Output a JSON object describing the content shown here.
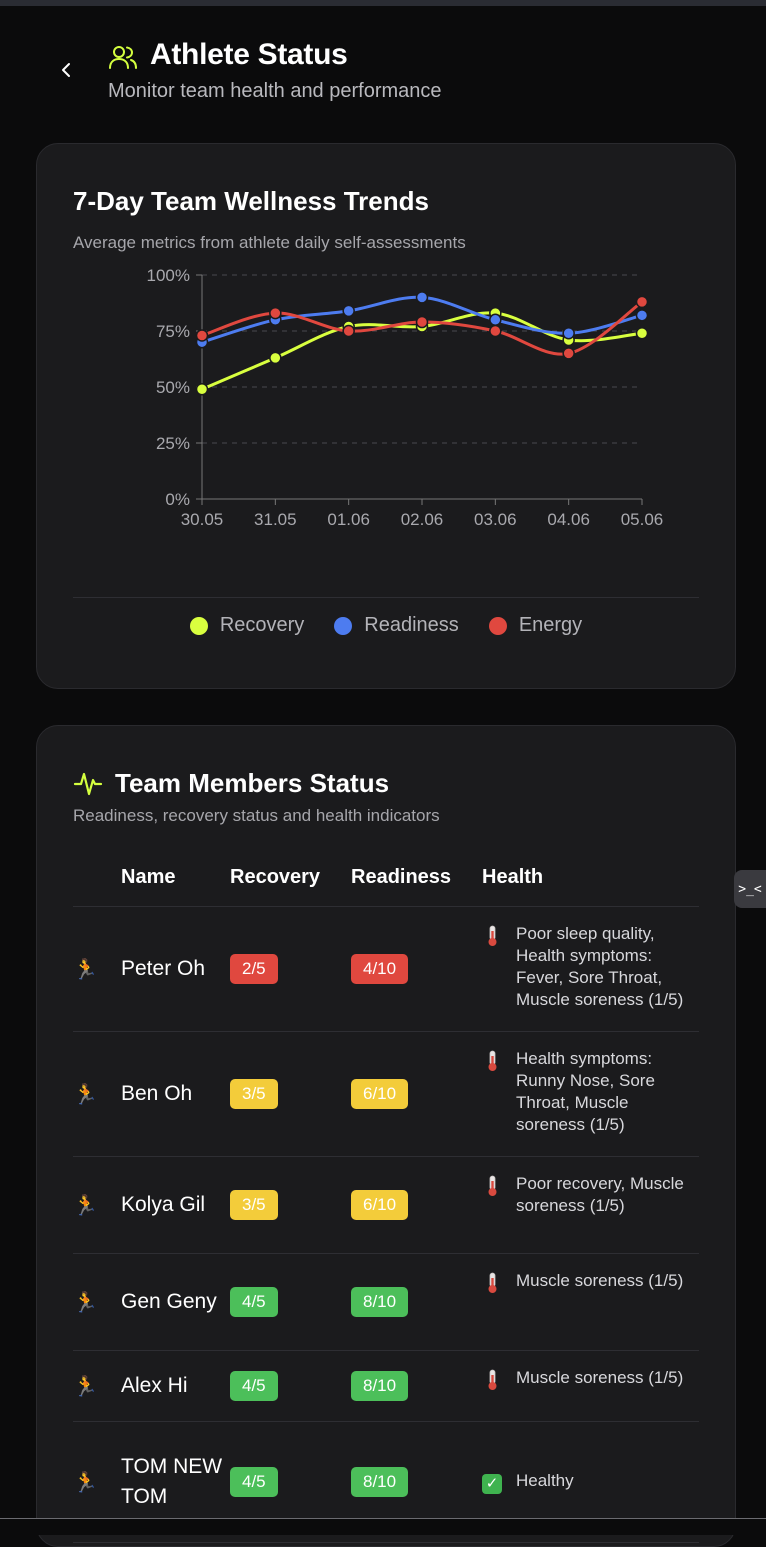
{
  "header": {
    "title": "Athlete Status",
    "subtitle": "Monitor team health and performance",
    "back_icon": "chevron-left-icon",
    "title_icon": "users-icon",
    "accent": "#d4ff3f"
  },
  "wellness_card": {
    "title": "7-Day Team Wellness Trends",
    "subtitle": "Average metrics from athlete daily self-assessments"
  },
  "chart_data": {
    "type": "line",
    "x": [
      "30.05",
      "31.05",
      "01.06",
      "02.06",
      "03.06",
      "04.06",
      "05.06"
    ],
    "ylim": [
      0,
      100
    ],
    "yticks": [
      "0%",
      "25%",
      "50%",
      "75%",
      "100%"
    ],
    "grid": true,
    "legend_position": "bottom",
    "series": [
      {
        "name": "Recovery",
        "color": "#d9ff3f",
        "values": [
          49,
          63,
          77,
          77,
          83,
          71,
          74
        ]
      },
      {
        "name": "Readiness",
        "color": "#4d7cf0",
        "values": [
          70,
          80,
          84,
          90,
          80,
          74,
          82
        ]
      },
      {
        "name": "Energy",
        "color": "#e0483f",
        "values": [
          73,
          83,
          75,
          79,
          75,
          65,
          88
        ]
      }
    ]
  },
  "team_card": {
    "title": "Team Members Status",
    "subtitle": "Readiness, recovery status and health indicators",
    "icon": "activity-pulse-icon",
    "columns": [
      "Name",
      "Recovery",
      "Readiness",
      "Health"
    ],
    "rows": [
      {
        "name": "Peter Oh",
        "recovery": "2/5",
        "recovery_level": "red",
        "readiness": "4/10",
        "readiness_level": "red",
        "health_icon": "thermometer-icon",
        "health": "Poor sleep quality, Health symptoms: Fever, Sore Throat, Muscle soreness (1/5)"
      },
      {
        "name": "Ben Oh",
        "recovery": "3/5",
        "recovery_level": "yellow",
        "readiness": "6/10",
        "readiness_level": "yellow",
        "health_icon": "thermometer-icon",
        "health": "Health symptoms: Runny Nose, Sore Throat, Muscle soreness (1/5)"
      },
      {
        "name": "Kolya Gil",
        "recovery": "3/5",
        "recovery_level": "yellow",
        "readiness": "6/10",
        "readiness_level": "yellow",
        "health_icon": "thermometer-icon",
        "health": "Poor recovery, Muscle soreness (1/5)"
      },
      {
        "name": "Gen Geny",
        "recovery": "4/5",
        "recovery_level": "green",
        "readiness": "8/10",
        "readiness_level": "green",
        "health_icon": "thermometer-icon",
        "health": "Muscle soreness (1/5)"
      },
      {
        "name": "Alex Hi",
        "recovery": "4/5",
        "recovery_level": "green",
        "readiness": "8/10",
        "readiness_level": "green",
        "health_icon": "thermometer-icon",
        "health": "Muscle soreness (1/5)"
      },
      {
        "name": "TOM NEW TOM",
        "recovery": "4/5",
        "recovery_level": "green",
        "readiness": "8/10",
        "readiness_level": "green",
        "health_icon": "check-mark-icon",
        "health": "Healthy"
      }
    ]
  },
  "side_tab": {
    "label": ">_<"
  }
}
